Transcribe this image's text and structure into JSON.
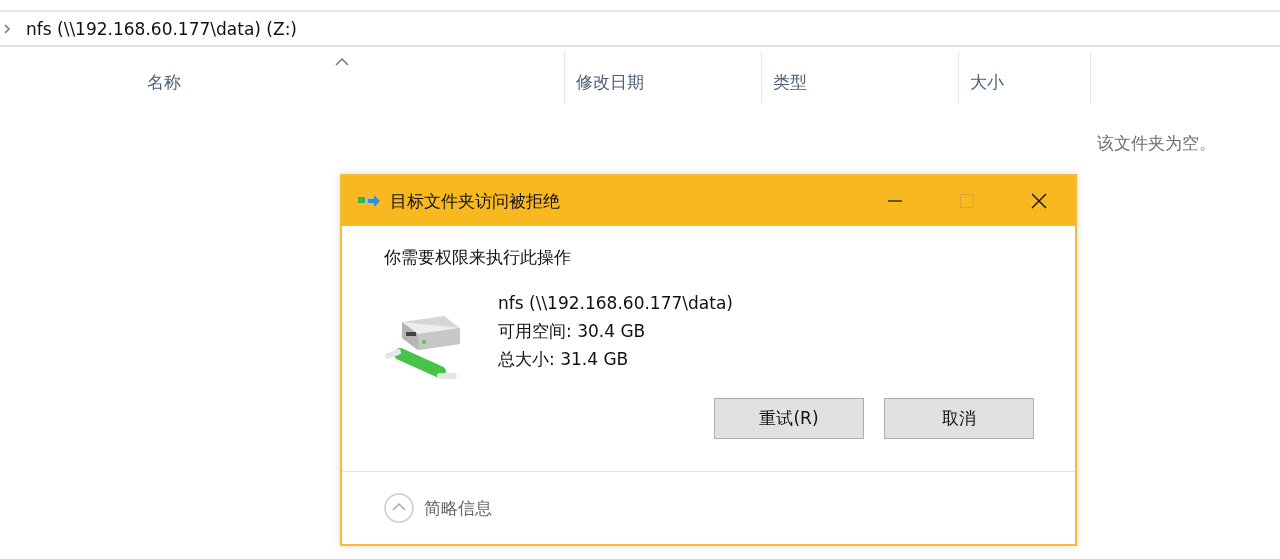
{
  "address_bar": {
    "path": "nfs (\\\\192.168.60.177\\data) (Z:)"
  },
  "columns": [
    {
      "label": "名称",
      "sorted": true
    },
    {
      "label": "修改日期",
      "sorted": false
    },
    {
      "label": "类型",
      "sorted": false
    },
    {
      "label": "大小",
      "sorted": false
    }
  ],
  "empty_message": "该文件夹为空。",
  "dialog": {
    "title": "目标文件夹访问被拒绝",
    "maximize_disabled": true,
    "message": "你需要权限来执行此操作",
    "drive": {
      "name": "nfs (\\\\192.168.60.177\\data)",
      "free_space": "可用空间: 30.4 GB",
      "total_size": "总大小: 31.4 GB"
    },
    "buttons": [
      "重试(R)",
      "取消"
    ],
    "details_toggle": {
      "label": "简略信息",
      "expanded": true
    }
  }
}
